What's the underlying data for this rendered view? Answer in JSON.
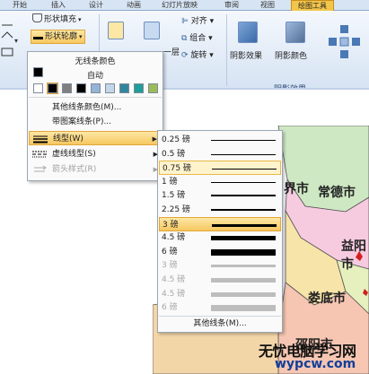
{
  "tabs": [
    "开始",
    "插入",
    "设计",
    "动画",
    "幻灯片放映",
    "审阅",
    "视图",
    "绘图工具"
  ],
  "ribbon": {
    "shape_fill": "形状填充",
    "shape_outline": "形状轮廓",
    "arrange": {
      "align": "对齐",
      "group": "组合",
      "rotate": "旋转",
      "layer": "一层"
    },
    "shadow_effect": "阴影效果",
    "shadow_color": "阴影颜色",
    "shadow_group": "阴影效果"
  },
  "outline_menu": {
    "no_line": "无线条颜色",
    "automatic": "自动",
    "swatches": [
      "#ffffff",
      "#000000",
      "#7f7f7f",
      "#000000",
      "#95b3d7",
      "#c4d7ea",
      "#31859b",
      "#1f9e9a",
      "#9bbb59"
    ],
    "more_colors": "其他线条颜色(M)...",
    "pattern_line": "带图案线条(P)...",
    "weight": "线型(W)",
    "dashes": "虚线线型(S)",
    "arrows": "箭头样式(R)"
  },
  "weight_menu": {
    "items": [
      {
        "label": "0.25 磅",
        "pt": 0.25
      },
      {
        "label": "0.5 磅",
        "pt": 0.5
      },
      {
        "label": "0.75 磅",
        "pt": 0.75
      },
      {
        "label": "1 磅",
        "pt": 1
      },
      {
        "label": "1.5 磅",
        "pt": 1.5
      },
      {
        "label": "2.25 磅",
        "pt": 2.25
      },
      {
        "label": "3 磅",
        "pt": 3
      },
      {
        "label": "4.5 磅",
        "pt": 4.5
      },
      {
        "label": "6 磅",
        "pt": 6
      },
      {
        "label": "3 磅",
        "pt": 3
      },
      {
        "label": "4.5 磅",
        "pt": 4.5
      },
      {
        "label": "4.5 磅",
        "pt": 4.5
      },
      {
        "label": "6 磅",
        "pt": 6
      }
    ],
    "more": "其他线条(M)..."
  },
  "map": {
    "cities": [
      "常德市",
      "益阳市",
      "娄底市",
      "邵阳市",
      "界市"
    ]
  },
  "watermark": {
    "line1": "无忧电脑学习网",
    "line2": "wypcw.com"
  }
}
